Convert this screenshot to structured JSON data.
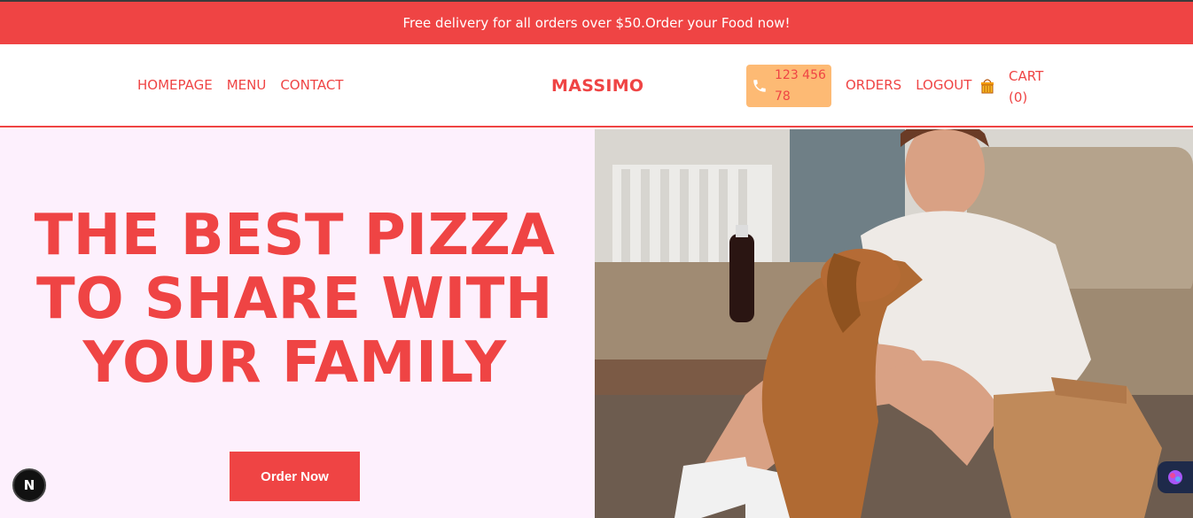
{
  "promo": {
    "text": "Free delivery for all orders over $50.Order your Food now!"
  },
  "nav": {
    "left": [
      "HOMEPAGE",
      "MENU",
      "CONTACT"
    ],
    "logo": "MASSIMO",
    "phone": "123 456 78",
    "right": [
      "ORDERS",
      "LOGOUT"
    ],
    "cart": "CART (0)"
  },
  "hero": {
    "headline": "THE BEST PIZZA TO SHARE WITH YOUR FAMILY",
    "cta": "Order Now"
  },
  "badges": {
    "next": "N"
  },
  "colors": {
    "brand": "#ef4444",
    "phone_bg": "#fdba74",
    "hero_bg": "#fdf0fd"
  },
  "icons": [
    "phone-icon",
    "cart-icon",
    "nextjs-icon",
    "extension-icon"
  ]
}
